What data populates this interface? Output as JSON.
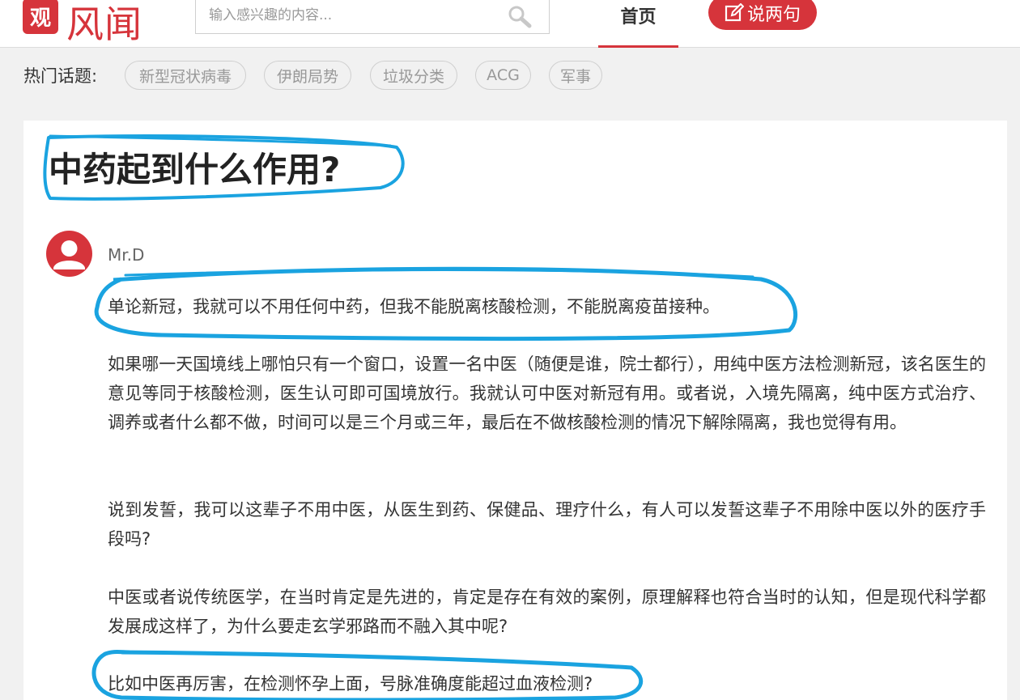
{
  "header": {
    "logo_glyph": "观",
    "site_name": "风闻",
    "search_placeholder": "输入感兴趣的内容...",
    "nav_home": "首页",
    "post_button": "说两句"
  },
  "topics": {
    "label": "热门话题:",
    "tags": [
      "新型冠状病毒",
      "伊朗局势",
      "垃圾分类",
      "ACG",
      "军事"
    ]
  },
  "article": {
    "title": "中药起到什么作用?",
    "author": "Mr.D",
    "paragraphs": [
      "单论新冠，我就可以不用任何中药，但我不能脱离核酸检测，不能脱离疫苗接种。",
      "如果哪一天国境线上哪怕只有一个窗口，设置一名中医（随便是谁，院士都行），用纯中医方法检测新冠，该名医生的意见等同于核酸检测，医生认可即可国境放行。我就认可中医对新冠有用。或者说，入境先隔离，纯中医方式治疗、调养或者什么都不做，时间可以是三个月或三年，最后在不做核酸检测的情况下解除隔离，我也觉得有用。",
      "说到发誓，我可以这辈子不用中医，从医生到药、保健品、理疗什么，有人可以发誓这辈子不用除中医以外的医疗手段吗?",
      "中医或者说传统医学，在当时肯定是先进的，肯定是存在有效的案例，原理解释也符合当时的认知，但是现代科学都发展成这样了，为什么要走玄学邪路而不融入其中呢?",
      "比如中医再厉害，在检测怀孕上面，号脉准确度能超过血液检测?"
    ]
  },
  "colors": {
    "brand_red": "#d6343b",
    "annotation_blue": "#1aa3e0"
  }
}
